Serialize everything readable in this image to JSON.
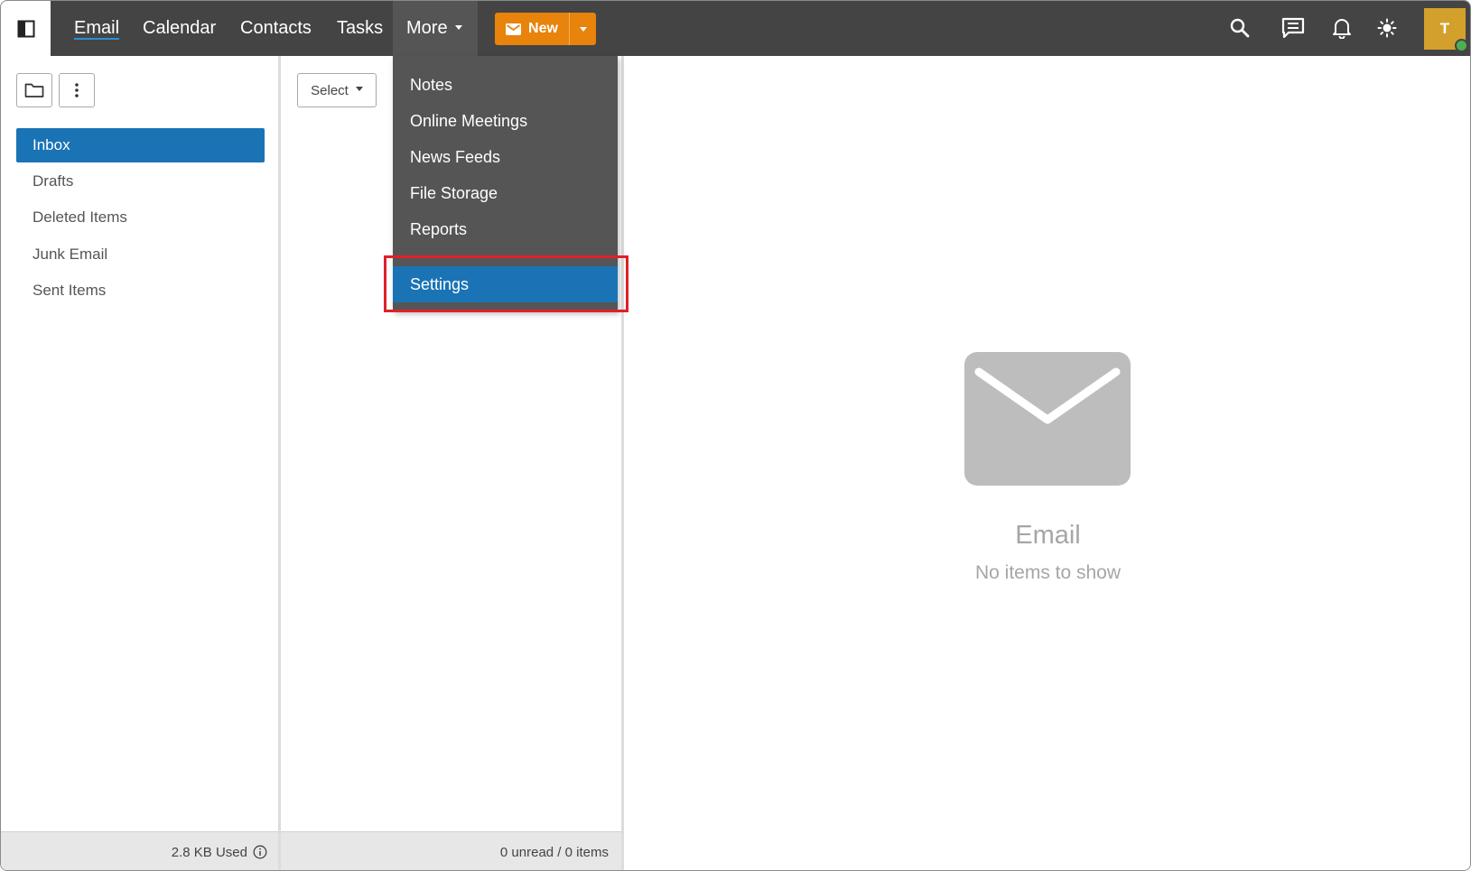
{
  "topbar": {
    "nav": [
      {
        "label": "Email"
      },
      {
        "label": "Calendar"
      },
      {
        "label": "Contacts"
      },
      {
        "label": "Tasks"
      }
    ],
    "more_label": "More",
    "new_label": "New",
    "avatar_initial": "T",
    "icons": [
      "sidebar-toggle-icon",
      "search-icon",
      "chat-icon",
      "bell-icon",
      "sun-icon"
    ]
  },
  "more_menu": {
    "items": [
      {
        "label": "Notes"
      },
      {
        "label": "Online Meetings"
      },
      {
        "label": "News Feeds"
      },
      {
        "label": "File Storage"
      },
      {
        "label": "Reports"
      }
    ],
    "settings_label": "Settings"
  },
  "folders": {
    "items": [
      {
        "label": "Inbox",
        "selected": true
      },
      {
        "label": "Drafts"
      },
      {
        "label": "Deleted Items"
      },
      {
        "label": "Junk Email"
      },
      {
        "label": "Sent Items"
      }
    ],
    "storage_used": "2.8 KB Used"
  },
  "message_list": {
    "select_label": "Select",
    "status": "0 unread / 0 items"
  },
  "reading_pane": {
    "empty_title": "Email",
    "empty_subtitle": "No items to show"
  },
  "colors": {
    "topbar": "#444444",
    "accent": "#1a73b5",
    "new_button": "#e8830c",
    "avatar": "#d4a02c",
    "highlight": "#e0202a"
  }
}
